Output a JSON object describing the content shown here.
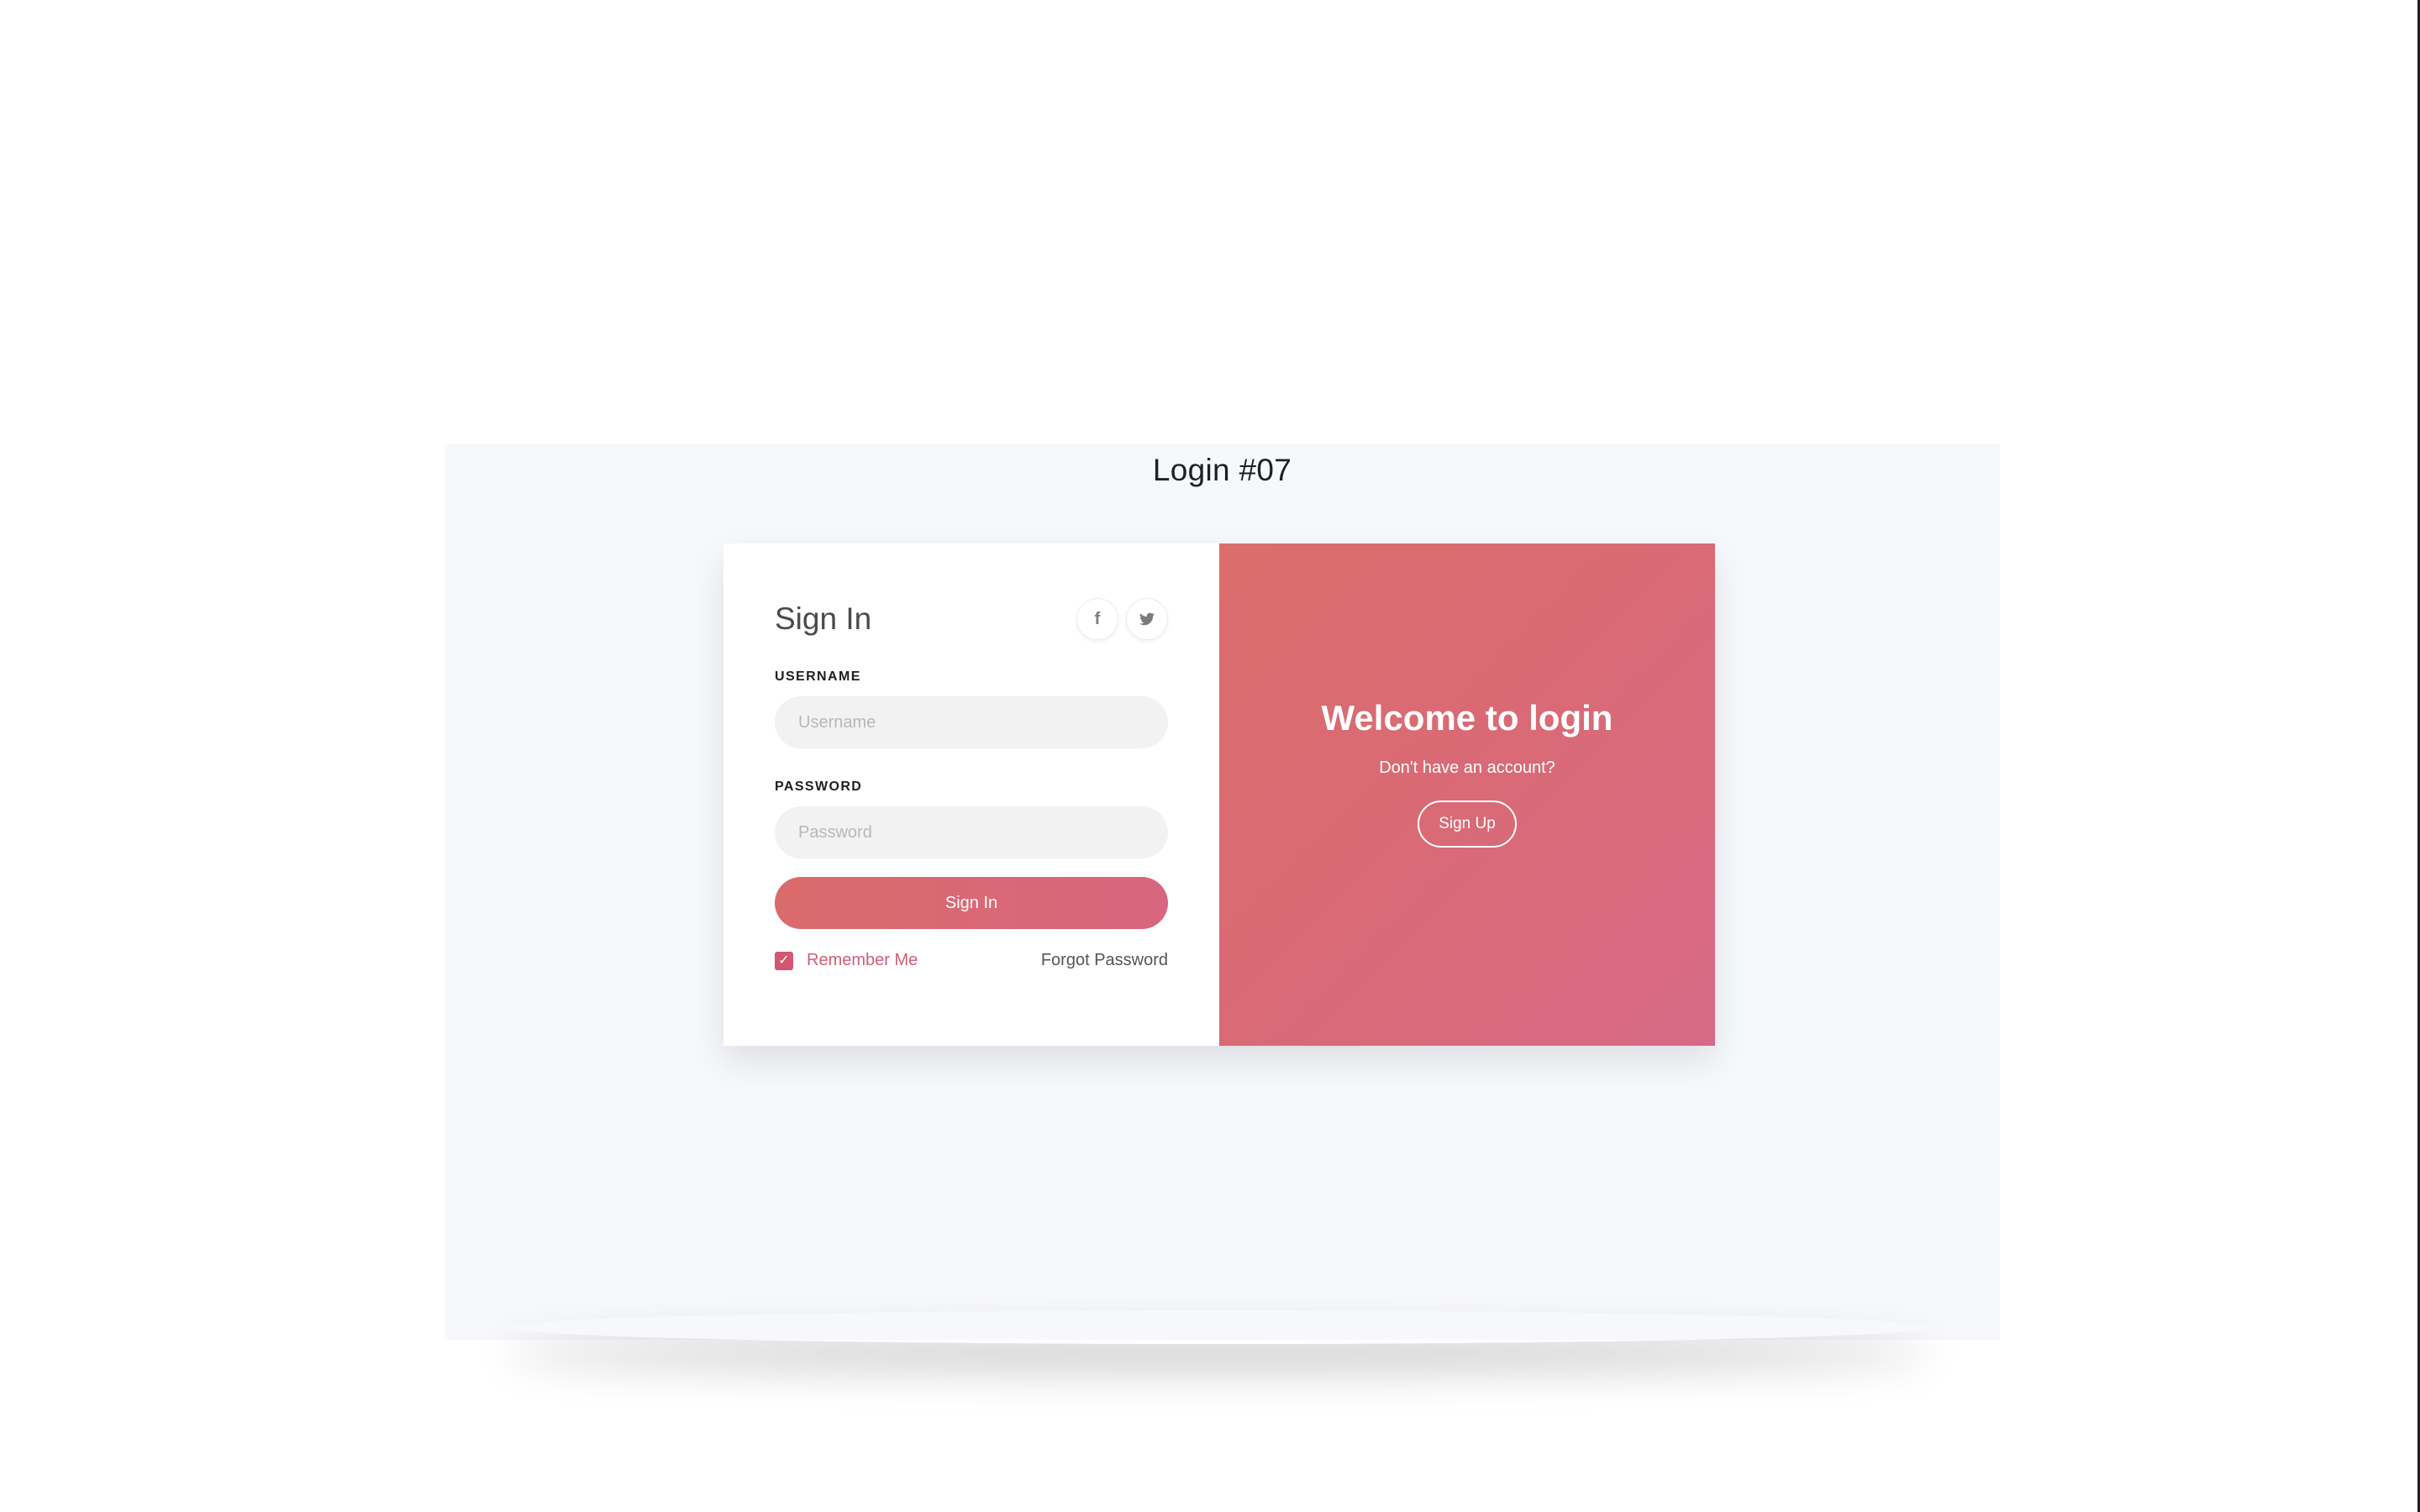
{
  "page": {
    "title": "Login #07"
  },
  "sign_in_form": {
    "title": "Sign In",
    "social": {
      "facebook_glyph": "f",
      "facebook_icon": "facebook-icon",
      "twitter_glyph": "𝕥",
      "twitter_icon": "twitter-icon"
    },
    "username": {
      "label": "USERNAME",
      "placeholder": "Username",
      "value": ""
    },
    "password": {
      "label": "PASSWORD",
      "placeholder": "Password",
      "value": ""
    },
    "submit_label": "Sign In",
    "remember_me": {
      "label": "Remember Me",
      "checked": true,
      "check_glyph": "✓"
    },
    "forgot_password_label": "Forgot Password"
  },
  "welcome_panel": {
    "title": "Welcome to login",
    "subtitle": "Don't have an account?",
    "signup_label": "Sign Up"
  },
  "colors": {
    "accent": "#d9657e",
    "gradient_start": "#da6b6b",
    "gradient_end": "#d66a86",
    "input_background": "#f2f2f2",
    "stage_background": "#f7f8fb"
  }
}
